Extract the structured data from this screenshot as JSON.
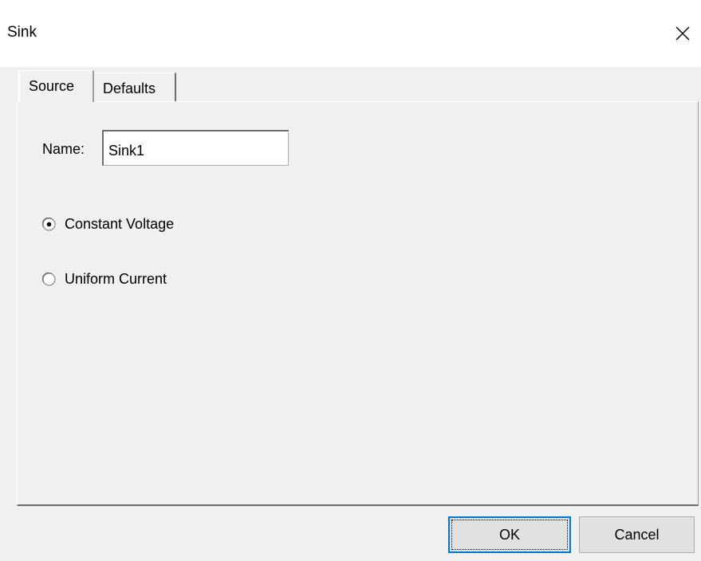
{
  "window": {
    "title": "Sink"
  },
  "tabs": [
    {
      "label": "Source",
      "active": true
    },
    {
      "label": "Defaults",
      "active": false
    }
  ],
  "form": {
    "name_label": "Name:",
    "name_value": "Sink1"
  },
  "options": [
    {
      "label": "Constant Voltage",
      "selected": true
    },
    {
      "label": "Uniform Current",
      "selected": false
    }
  ],
  "buttons": {
    "ok_label": "OK",
    "cancel_label": "Cancel"
  },
  "colors": {
    "focus_border": "#0078d7",
    "dialog_background": "#f0f0f0"
  },
  "icons": {
    "close": "close-icon"
  }
}
